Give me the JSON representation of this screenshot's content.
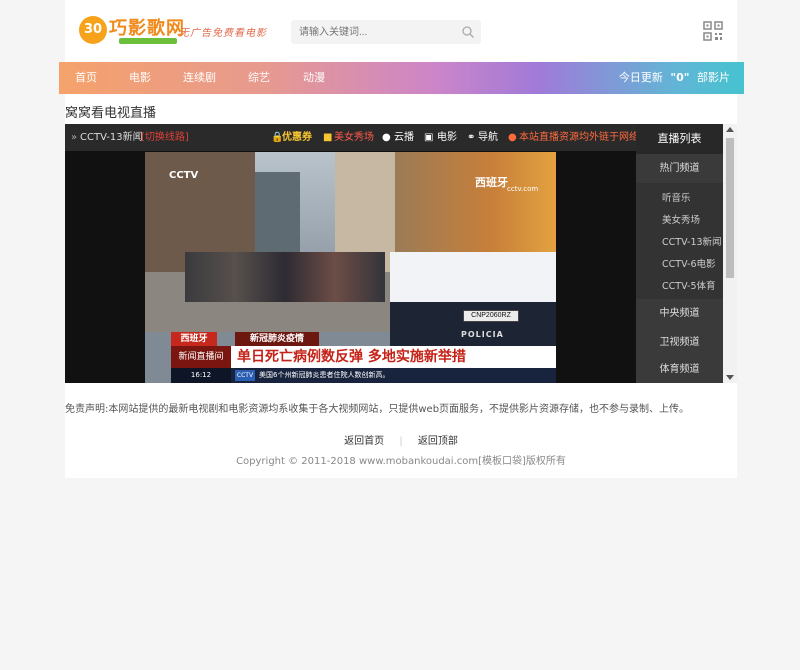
{
  "header": {
    "logo_text": "巧影歌网",
    "logo_badge": "30",
    "slogan": "无广告免费看电影",
    "search_placeholder": "请输入关键词..."
  },
  "nav": {
    "items": [
      "首页",
      "电影",
      "连续剧",
      "综艺",
      "动漫"
    ],
    "update_prefix": "今日更新",
    "update_count": "\"0\"",
    "update_suffix": "部影片"
  },
  "page_title": "窝窝看电视直播",
  "player": {
    "channel_label": "CCTV-13新闻",
    "switch_line": "[切换线路]",
    "toolbar": {
      "coupon": "优惠券",
      "beauty_show": "美女秀场",
      "cloud": "云播",
      "movie": "电影",
      "nav": "导航",
      "notice": "本站直播资源均外链于网络"
    },
    "video_overlay": {
      "station": "CCTV",
      "location": "西班牙",
      "location_sub": "cctv.com",
      "tag1": "西班牙",
      "tag2": "新冠肺炎疫情",
      "live": "新闻直播间",
      "headline": "单日死亡病例数反弹 多地实施新举措",
      "time": "16:12",
      "ticker": "美国6个州新冠肺炎患者住院人数创新高。",
      "plate": "CNP2060RZ",
      "police": "POLICIA"
    }
  },
  "sidebar": {
    "title": "直播列表",
    "groups": [
      "热门频道",
      "中央频道",
      "卫视频道",
      "体育频道"
    ],
    "hot_channels": [
      "听音乐",
      "美女秀场",
      "CCTV-13新闻",
      "CCTV-6电影",
      "CCTV-5体育"
    ]
  },
  "footer": {
    "disclaimer": "免责声明:本网站提供的最新电视剧和电影资源均系收集于各大视频网站，只提供web页面服务，不提供影片资源存储，也不参与录制、上传。",
    "link_home": "返回首页",
    "link_top": "返回顶部",
    "copyright": "Copyright © 2011-2018 www.mobankoudai.com[模板口袋]版权所有"
  },
  "colors": {
    "nav_gradient_start": "#f5a26b",
    "nav_gradient_end": "#45c3cf",
    "accent_orange": "#f08a1c",
    "notice_red": "#ff6a3d",
    "coupon_yellow": "#f7c531"
  }
}
